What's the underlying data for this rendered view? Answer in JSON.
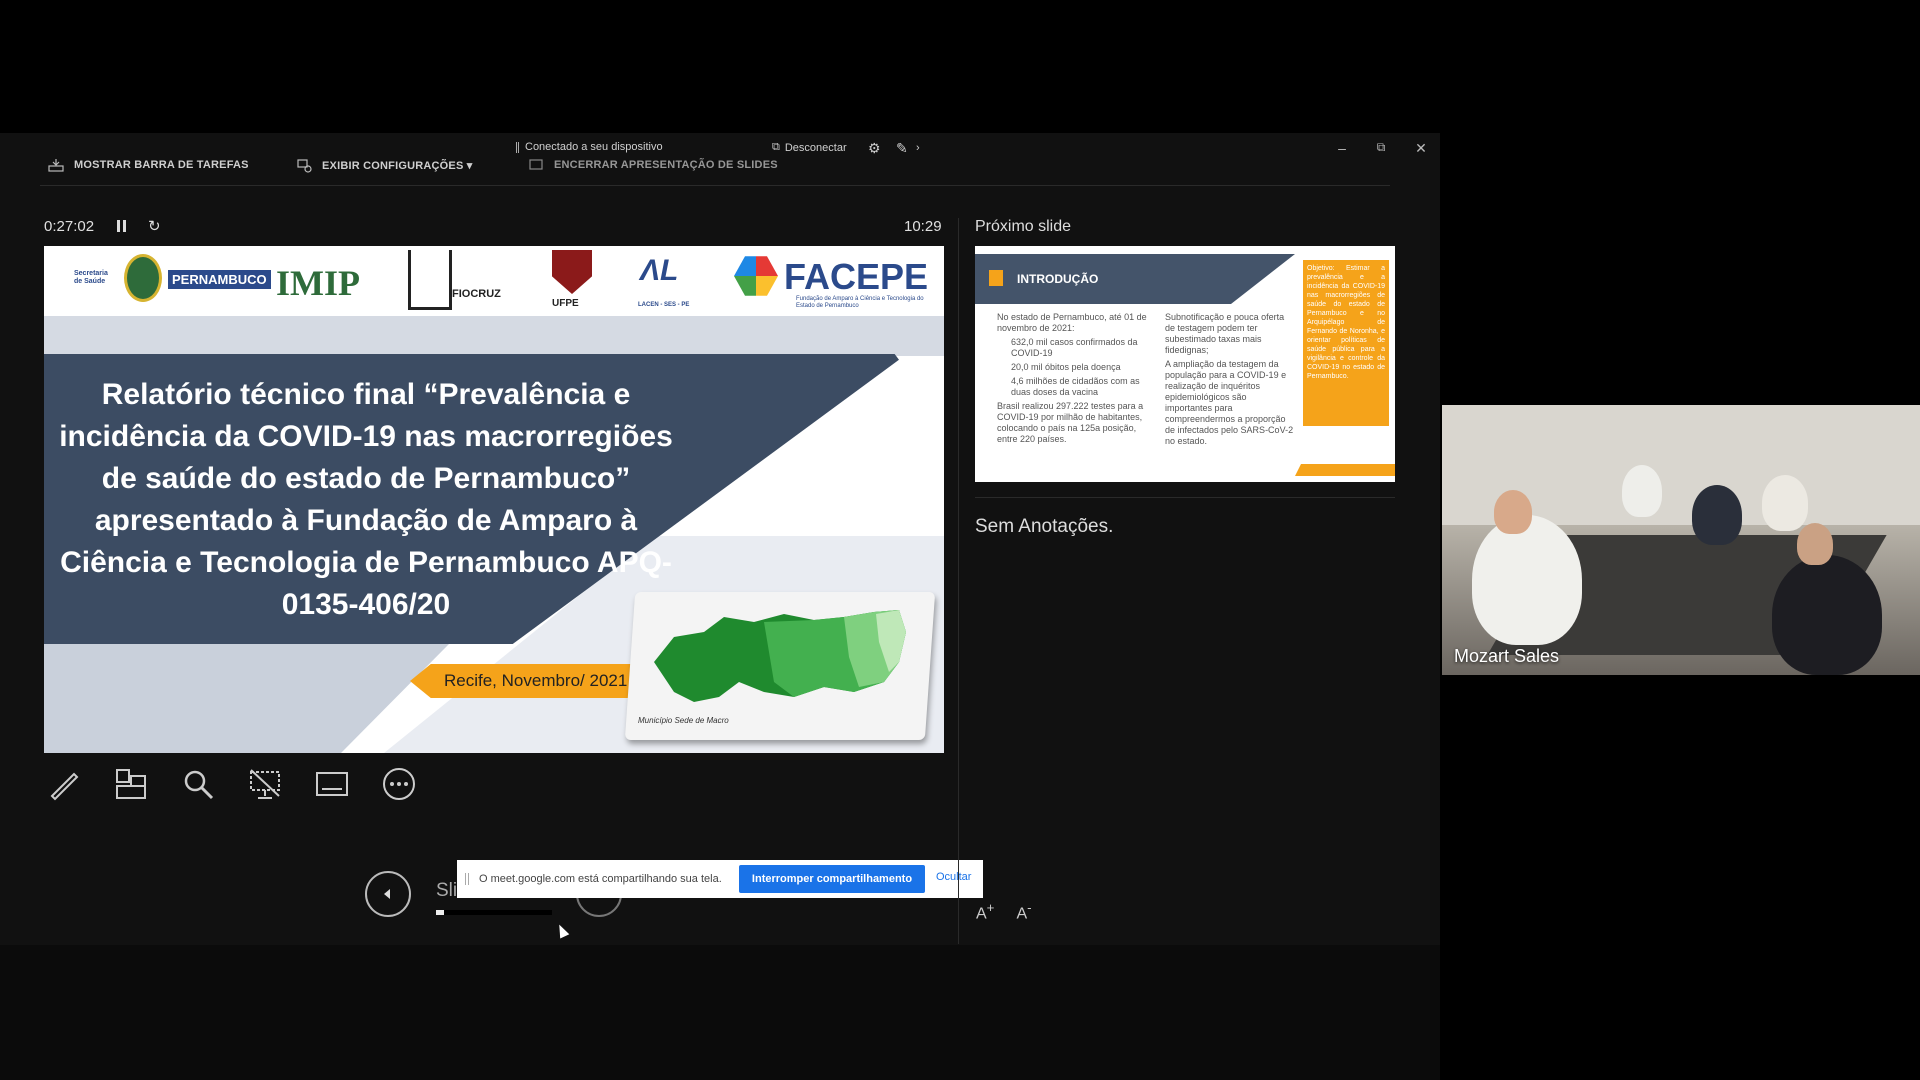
{
  "topbar": {
    "show_taskbar": "MOSTRAR BARRA DE TAREFAS",
    "display_settings": "EXIBIR CONFIGURAÇÕES ▾",
    "end_show": "ENCERRAR APRESENTAÇÃO DE SLIDES"
  },
  "cast": {
    "status": "Conectado a seu dispositivo",
    "disconnect": "Desconectar"
  },
  "presenter": {
    "elapsed": "0:27:02",
    "clock": "10:29",
    "next_slide_label": "Próximo slide",
    "notes": "Sem Anotações.",
    "slide_counter": "Slide 1 de 15",
    "progress": 0.07
  },
  "current_slide": {
    "logos": [
      "Secretaria de Saúde",
      "PERNAMBUCO",
      "IMIP",
      "FIOCRUZ",
      "UFPE",
      "LACEN - SES - PE",
      "FACEPE",
      "Fundação de Amparo à Ciência e Tecnologia do Estado de Pernambuco"
    ],
    "title": "Relatório técnico final “Prevalência e incidência da COVID-19 nas macrorregiões de saúde do estado de Pernambuco” apresentado à Fundação de Amparo à Ciência e Tecnologia de Pernambuco APQ-0135-406/20",
    "place_date": "Recife, Novembro/ 2021",
    "map_caption": "Município Sede de Macro"
  },
  "next_slide": {
    "heading": "INTRODUÇÃO",
    "left_items": [
      "No estado de Pernambuco, até 01 de novembro de 2021:",
      "632,0 mil casos confirmados da COVID-19",
      "20,0 mil óbitos pela doença",
      "4,6 milhões de cidadãos com as duas doses da vacina",
      "Brasil realizou 297.222 testes para a COVID-19 por milhão de habitantes, colocando o país na 125a posição, entre 220 países."
    ],
    "right_items": [
      "Subnotificação e pouca oferta de testagem podem ter subestimado taxas mais fidedignas;",
      "A ampliação da testagem da população para a COVID-19 e realização de inquéritos epidemiológicos são importantes para compreendermos a proporção de infectados pelo SARS-CoV-2 no estado."
    ],
    "objective": "Objetivo: Estimar a prevalência e a incidência da COVID-19 nas macrorregiões de saúde do estado de Pernambuco e no Arquipélago de Fernando de Noronha, e orientar políticas de saúde pública para a vigilância e controle da COVID-19 no estado de Pernambuco."
  },
  "share_notification": {
    "message": "O meet.google.com está compartilhando sua tela.",
    "stop": "Interromper compartilhamento",
    "hide": "Ocultar"
  },
  "video": {
    "participant": "Mozart Sales"
  },
  "colors": {
    "slide_navy": "#44546a",
    "slide_orange": "#f5a31a",
    "meet_blue": "#1a73e8"
  }
}
